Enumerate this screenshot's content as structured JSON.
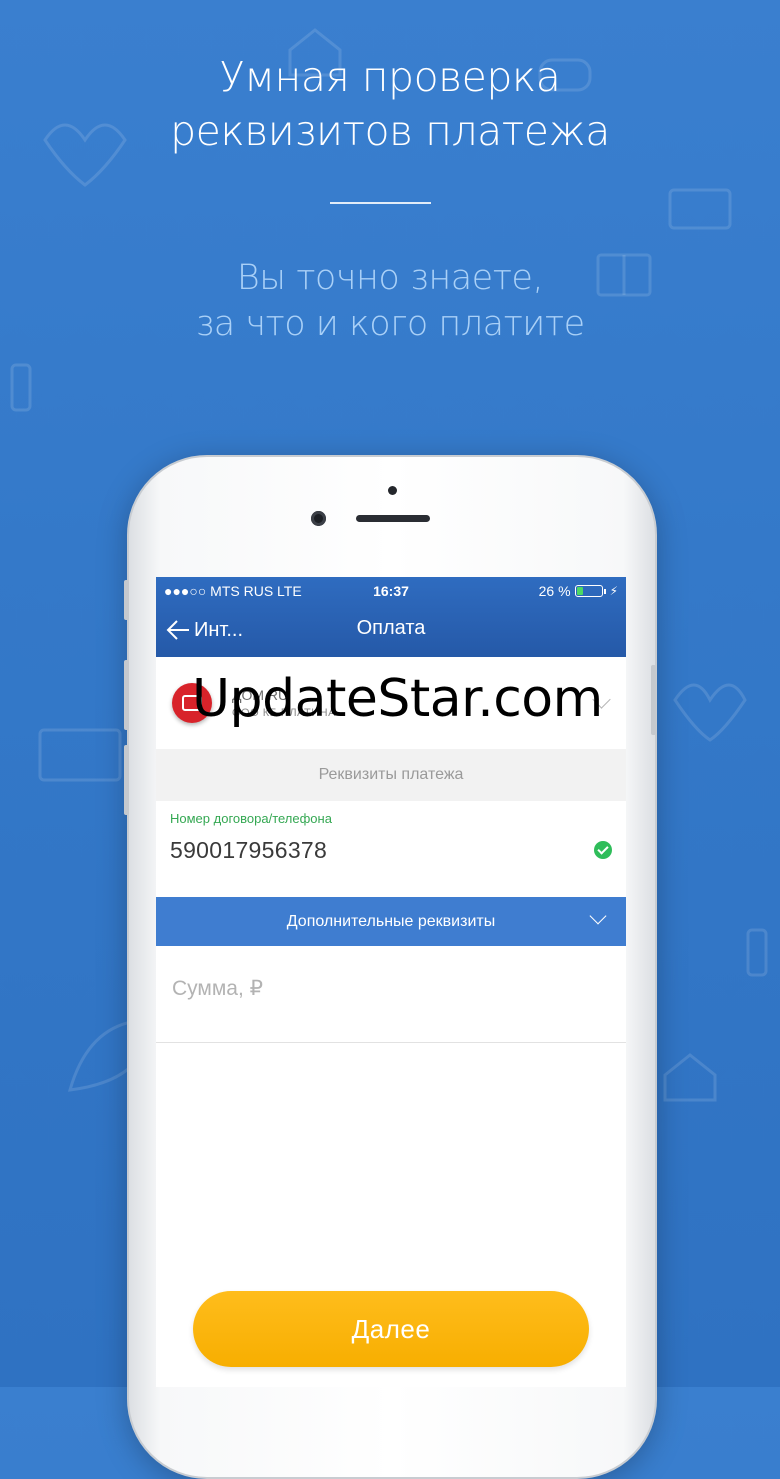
{
  "promo": {
    "title_line1": "Умная проверка",
    "title_line2": "реквизитов платежа",
    "subtitle_line1": "Вы точно знаете,",
    "subtitle_line2": "за что и кого платите"
  },
  "status_bar": {
    "carrier": "●●●○○ MTS RUS   LTE",
    "time": "16:37",
    "battery": "26 %",
    "battery_level": 0.26
  },
  "navbar": {
    "back_label": "Инт...",
    "title": "Оплата"
  },
  "provider": {
    "name": "ДОМ.RU",
    "subtitle": "ООО КБ ПЛАТИНА"
  },
  "watermark": "UpdateStar.com",
  "form": {
    "section_label": "Реквизиты платежа",
    "account_label": "Номер договора/телефона",
    "account_value": "590017956378",
    "extra_label": "Дополнительные реквизиты",
    "amount_placeholder": "Сумма, ₽"
  },
  "actions": {
    "next_label": "Далее"
  },
  "colors": {
    "background": "#3479c9",
    "navbar": "#2a62b4",
    "accent_button": "#f9b30a",
    "success": "#2fbd5a",
    "extra_bar": "#3f7dd0"
  }
}
